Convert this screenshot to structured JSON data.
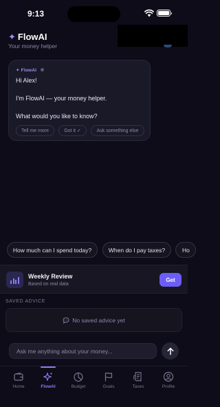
{
  "status_bar": {
    "time": "9:13"
  },
  "header": {
    "brand_icon": "✦",
    "brand": "FlowAI",
    "subtitle": "Your money helper"
  },
  "chat_bubble": {
    "tag": "✦ FlowAI",
    "greeting": "Hi Alex!",
    "intro": "I'm FlowAI — your money helper.",
    "question": "What would you like to know?",
    "chips": [
      "Tell me more",
      "Got it ✓",
      "Ask something else"
    ]
  },
  "suggestions": [
    "How much can I spend today?",
    "When do I pay taxes?",
    "Ho"
  ],
  "weekly_review": {
    "title": "Weekly Review",
    "subtitle": "Based on real data",
    "button": "Get"
  },
  "saved_advice": {
    "label": "SAVED ADVICE",
    "empty_text": "No saved advice yet"
  },
  "composer": {
    "placeholder": "Ask me anything about your money..."
  },
  "tabs": [
    {
      "label": "Home",
      "icon": "wallet-icon"
    },
    {
      "label": "FlowAI",
      "icon": "sparkles-icon",
      "active": true
    },
    {
      "label": "Budget",
      "icon": "pie-chart-icon"
    },
    {
      "label": "Goals",
      "icon": "flag-icon"
    },
    {
      "label": "Taxes",
      "icon": "receipt-icon"
    },
    {
      "label": "Profile",
      "icon": "profile-icon"
    }
  ],
  "colors": {
    "background": "#0d0c18",
    "accent": "#6d5df6",
    "accent_light": "#a78bfa"
  }
}
